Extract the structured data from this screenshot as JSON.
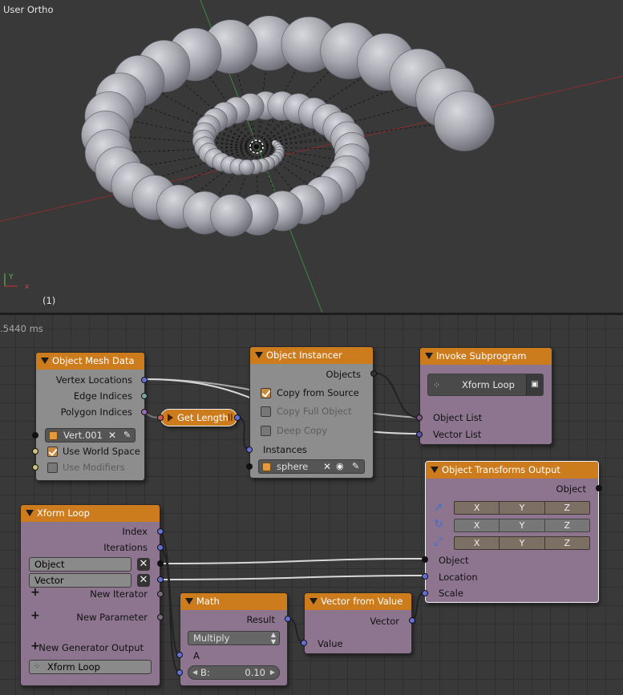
{
  "viewport": {
    "view_label": "User Ortho",
    "frame_label": "(1)"
  },
  "editor": {
    "timing": ".5440 ms"
  },
  "nodes": {
    "object_mesh_data": {
      "title": "Object Mesh Data",
      "outputs": [
        "Vertex Locations",
        "Edge Indices",
        "Polygon Indices"
      ],
      "object_value": "Vert.001",
      "use_world_space": {
        "label": "Use World Space",
        "checked": true
      },
      "use_modifiers": {
        "label": "Use Modifiers",
        "checked": false
      }
    },
    "get_length": {
      "title": "Get Length"
    },
    "object_instancer": {
      "title": "Object Instancer",
      "output": "Objects",
      "copy_from_source": {
        "label": "Copy from Source",
        "checked": true
      },
      "copy_full_object": {
        "label": "Copy Full Object",
        "checked": false
      },
      "deep_copy": {
        "label": "Deep Copy",
        "checked": false
      },
      "instances_label": "Instances",
      "object_value": "sphere"
    },
    "invoke_subprogram": {
      "title": "Invoke Subprogram",
      "subprogram": "Xform Loop",
      "inputs": [
        "Object List",
        "Vector List"
      ]
    },
    "object_transforms_output": {
      "title": "Object Transforms Output",
      "output": "Object",
      "axes": [
        "X",
        "Y",
        "Z"
      ],
      "inputs": [
        "Object",
        "Location",
        "Scale"
      ]
    },
    "xform_loop": {
      "title": "Xform Loop",
      "outputs": [
        "Index",
        "Iterations"
      ],
      "params": [
        "Object",
        "Vector"
      ],
      "new_iterator": "New Iterator",
      "new_parameter": "New Parameter",
      "new_generator_output": "New Generator Output",
      "loop_name": "Xform Loop"
    },
    "math": {
      "title": "Math",
      "output": "Result",
      "operation": "Multiply",
      "input_a": "A",
      "input_b_label": "B:",
      "input_b_value": "0.10"
    },
    "vector_from_value": {
      "title": "Vector from Value",
      "output": "Vector",
      "input": "Value"
    }
  },
  "colors": {
    "node_header": "#cc7b1d",
    "node_body": "#8d7590",
    "socket_vector": "#6470d6",
    "socket_object": "#111111"
  }
}
